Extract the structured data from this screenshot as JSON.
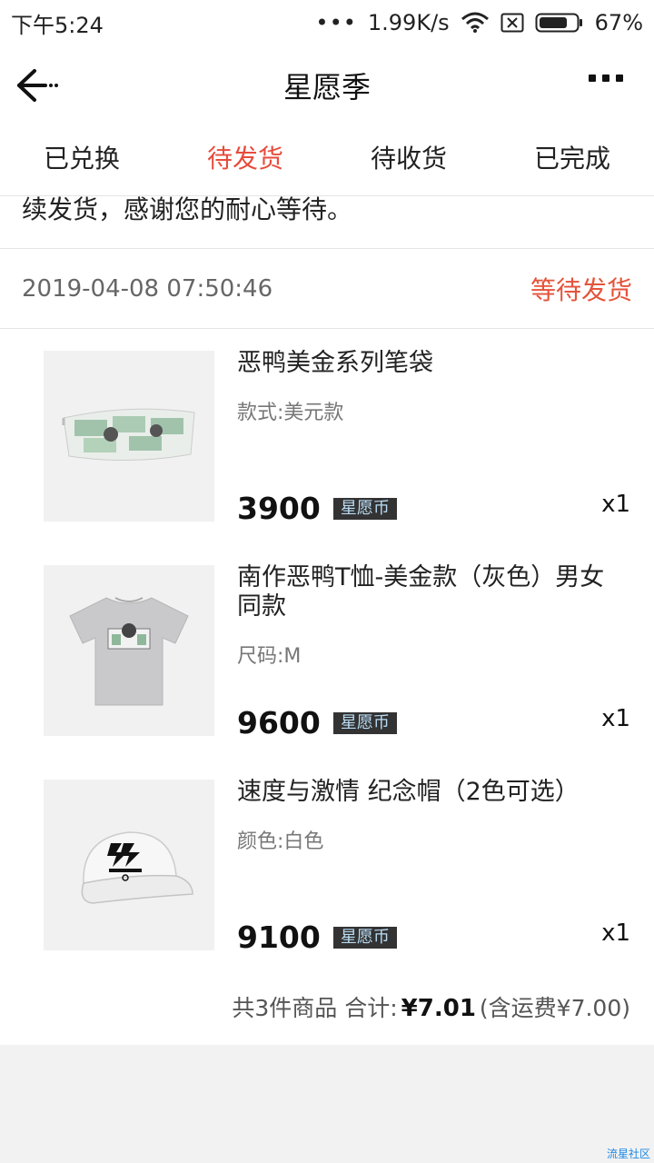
{
  "status_bar": {
    "time": "下午5:24",
    "net_dots": "•••",
    "speed": "1.99K/s",
    "battery": "67%",
    "icons": [
      "wifi-icon",
      "sim-blocked-icon",
      "battery-icon"
    ]
  },
  "nav": {
    "title": "星愿季",
    "back_icon": "back-arrow-icon",
    "more_icon": "more-dots-icon"
  },
  "tabs": [
    {
      "label": "已兑换",
      "active": false
    },
    {
      "label": "待发货",
      "active": true
    },
    {
      "label": "待收货",
      "active": false
    },
    {
      "label": "已完成",
      "active": false
    }
  ],
  "notice": "续发货，感谢您的耐心等待。",
  "order": {
    "date": "2019-04-08 07:50:46",
    "status": "等待发货",
    "items": [
      {
        "name": "恶鸭美金系列笔袋",
        "spec": "款式:美元款",
        "price": "3900",
        "currency": "星愿币",
        "qty": "x1",
        "image": "pencil-case"
      },
      {
        "name": "南作恶鸭T恤-美金款（灰色）男女同款",
        "spec": "尺码:M",
        "price": "9600",
        "currency": "星愿币",
        "qty": "x1",
        "image": "t-shirt"
      },
      {
        "name": "速度与激情 纪念帽（2色可选）",
        "spec": "颜色:白色",
        "price": "9100",
        "currency": "星愿币",
        "qty": "x1",
        "image": "cap"
      }
    ],
    "summary": {
      "count_text": "共3件商品 合计:",
      "total": "¥7.01",
      "shipping": "(含运费¥7.00)"
    }
  },
  "watermark": "流星社区",
  "colors": {
    "accent": "#e74c3c",
    "status": "#e5533a",
    "badge_bg": "#333333",
    "badge_text": "#b9dcf4"
  }
}
